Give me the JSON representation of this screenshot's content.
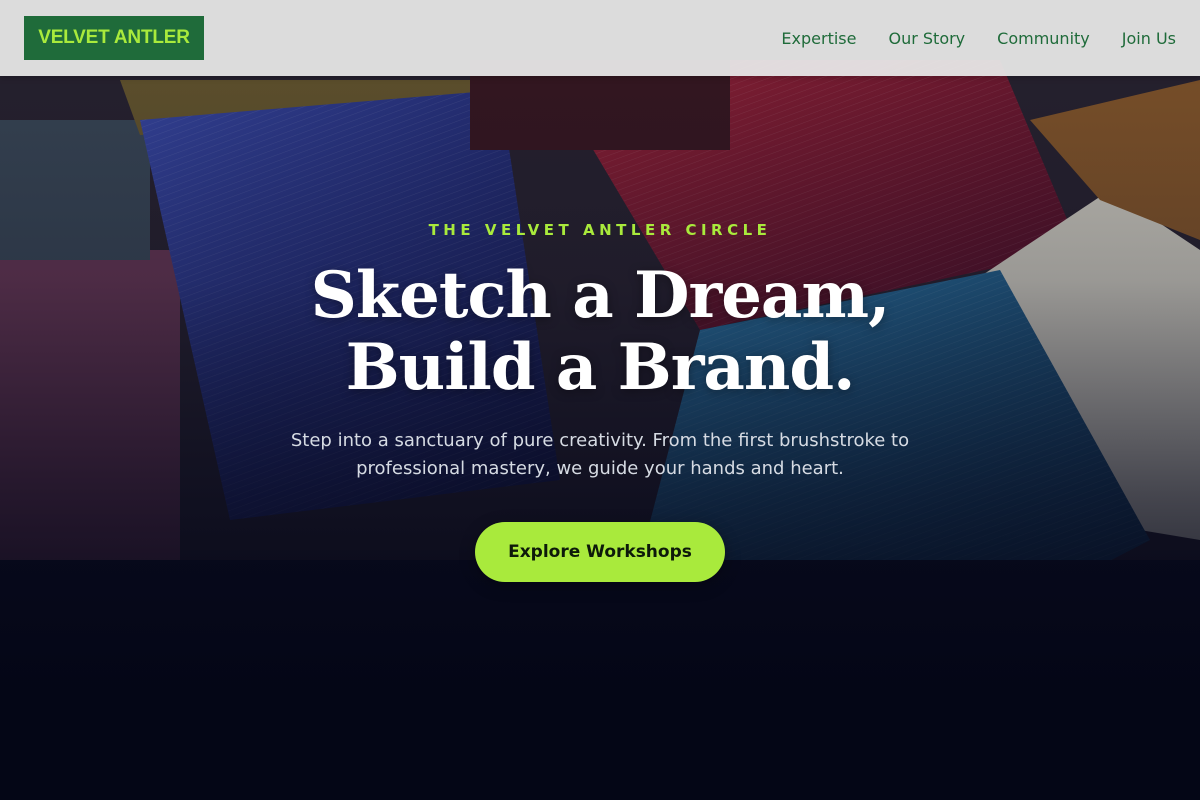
{
  "brand": {
    "name": "VELVET ANTLER",
    "logo_bg": "#1f6b3a",
    "logo_text_color": "#a9ea3c"
  },
  "nav": {
    "items": [
      {
        "label": "Expertise"
      },
      {
        "label": "Our Story"
      },
      {
        "label": "Community"
      },
      {
        "label": "Join Us"
      }
    ],
    "link_color": "#1f6b3a"
  },
  "hero": {
    "eyebrow": "THE VELVET ANTLER CIRCLE",
    "headline_line1": "Sketch a Dream,",
    "headline_line2": "Build a Brand.",
    "subtext": "Step into a sanctuary of pure creativity. From the first brushstroke to professional mastery, we guide your hands and heart.",
    "cta_label": "Explore Workshops",
    "accent_color": "#a9ea3c",
    "background_image": "paint-brushes-photo"
  }
}
